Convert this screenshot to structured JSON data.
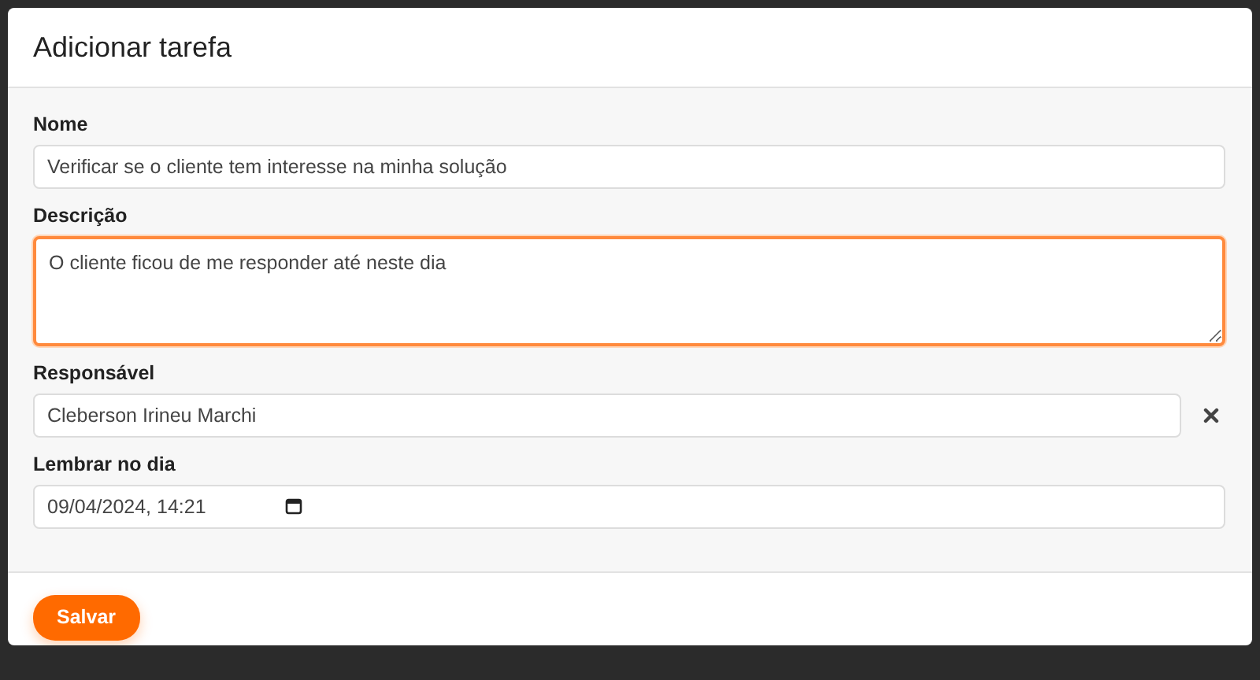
{
  "dialog": {
    "title": "Adicionar tarefa",
    "fields": [
      {
        "kind": "text",
        "label": "Nome",
        "value": "Verificar se o cliente tem interesse na minha solução",
        "focused": false
      },
      {
        "kind": "textarea",
        "label": "Descrição",
        "value": "O cliente ficou de me responder até neste dia",
        "focused": true
      },
      {
        "kind": "select",
        "label": "Responsável",
        "value": "Cleberson Irineu Marchi",
        "focused": false,
        "clearable": true
      },
      {
        "kind": "datetime",
        "label": "Lembrar no dia",
        "value": "09/04/2024, 14:21",
        "focused": false
      }
    ],
    "buttons": [
      "Salvar"
    ]
  }
}
